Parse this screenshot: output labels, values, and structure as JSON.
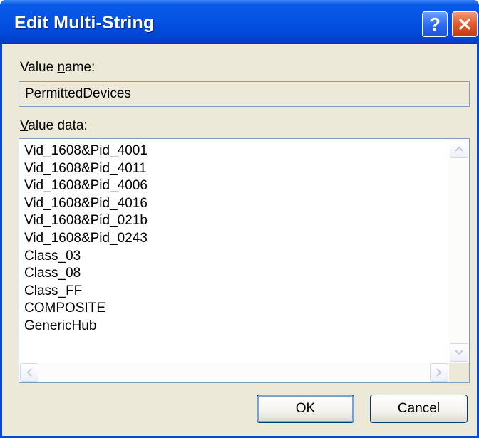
{
  "window": {
    "title": "Edit Multi-String",
    "help_label": "?",
    "close_icon": "close-icon"
  },
  "value_name": {
    "label_prefix": "Value ",
    "label_accel": "n",
    "label_suffix": "ame:",
    "value": "PermittedDevices"
  },
  "value_data": {
    "label_accel": "V",
    "label_suffix": "alue data:",
    "lines": [
      "Vid_1608&Pid_4001",
      "Vid_1608&Pid_4011",
      "Vid_1608&Pid_4006",
      "Vid_1608&Pid_4016",
      "Vid_1608&Pid_021b",
      "Vid_1608&Pid_0243",
      "Class_03",
      "Class_08",
      "Class_FF",
      "COMPOSITE",
      "GenericHub"
    ]
  },
  "buttons": {
    "ok": "OK",
    "cancel": "Cancel"
  },
  "colors": {
    "titlebar": "#0553e4",
    "client": "#ece9d8",
    "close_button": "#e25a2a"
  }
}
